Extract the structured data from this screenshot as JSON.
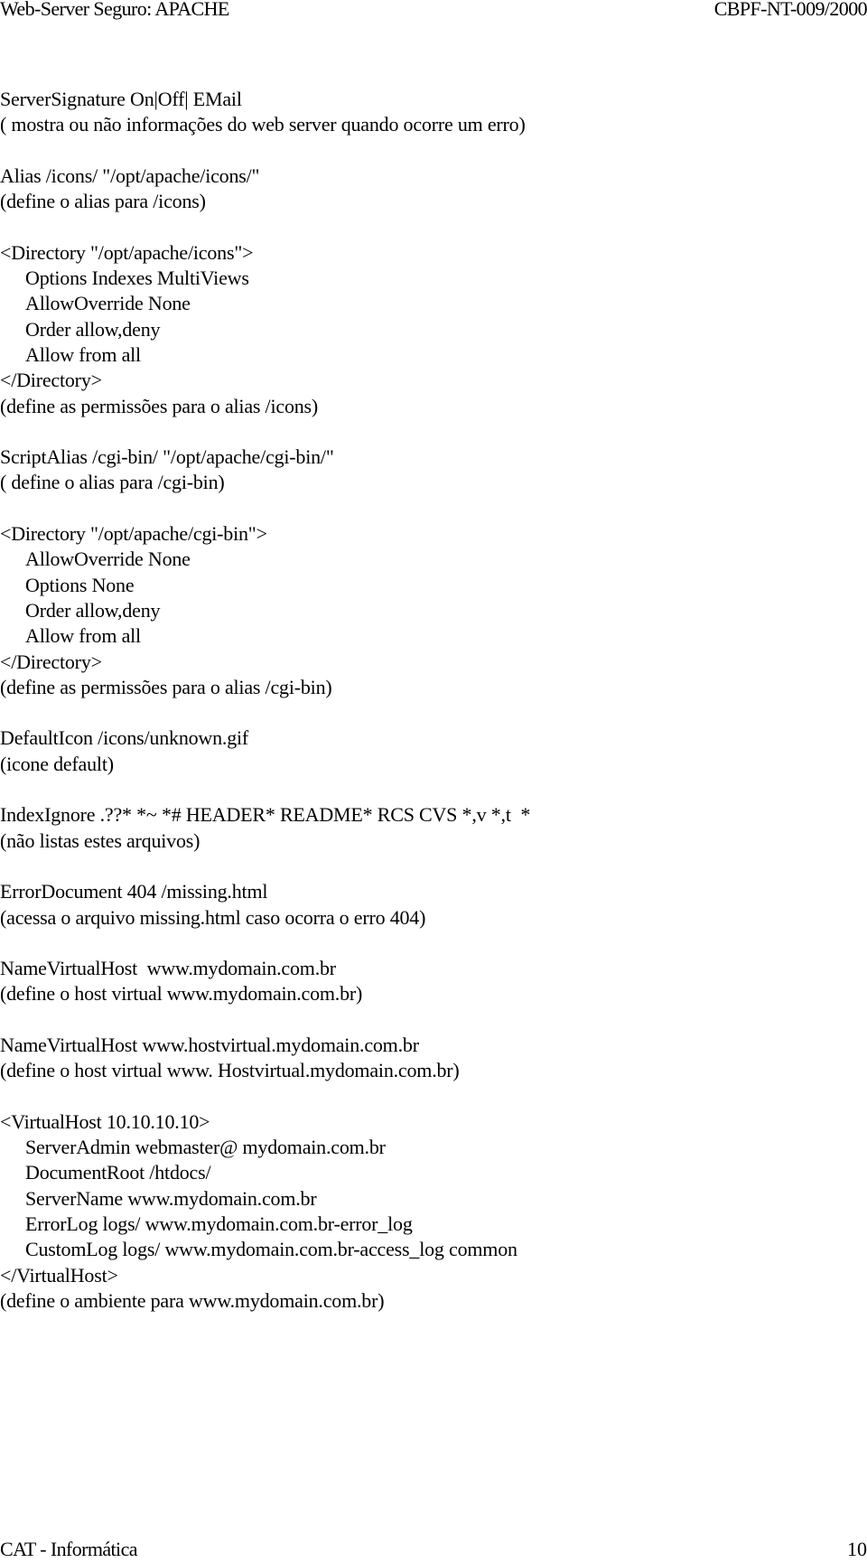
{
  "header": {
    "title": "Web-Server Seguro: APACHE",
    "doc_id": "CBPF-NT-009/2000"
  },
  "lines": [
    {
      "text": "ServerSignature On|Off| EMail",
      "indent": false
    },
    {
      "text": "( mostra ou não informações do web server quando ocorre um erro)",
      "indent": false
    },
    {
      "text": "",
      "indent": false
    },
    {
      "text": "Alias /icons/ \"/opt/apache/icons/\"",
      "indent": false
    },
    {
      "text": "(define o alias para /icons)",
      "indent": false
    },
    {
      "text": "",
      "indent": false
    },
    {
      "text": "<Directory \"/opt/apache/icons\">",
      "indent": false
    },
    {
      "text": "Options Indexes MultiViews",
      "indent": true
    },
    {
      "text": "AllowOverride None",
      "indent": true
    },
    {
      "text": "Order allow,deny",
      "indent": true
    },
    {
      "text": "Allow from all",
      "indent": true
    },
    {
      "text": "</Directory>",
      "indent": false
    },
    {
      "text": "(define as permissões para o alias /icons)",
      "indent": false
    },
    {
      "text": "",
      "indent": false
    },
    {
      "text": "ScriptAlias /cgi-bin/ \"/opt/apache/cgi-bin/\"",
      "indent": false
    },
    {
      "text": "( define o alias para /cgi-bin)",
      "indent": false
    },
    {
      "text": "",
      "indent": false
    },
    {
      "text": "<Directory \"/opt/apache/cgi-bin\">",
      "indent": false
    },
    {
      "text": "AllowOverride None",
      "indent": true
    },
    {
      "text": "Options None",
      "indent": true
    },
    {
      "text": "Order allow,deny",
      "indent": true
    },
    {
      "text": "Allow from all",
      "indent": true
    },
    {
      "text": "</Directory>",
      "indent": false
    },
    {
      "text": "(define as permissões para o alias /cgi-bin)",
      "indent": false
    },
    {
      "text": "",
      "indent": false
    },
    {
      "text": "DefaultIcon /icons/unknown.gif",
      "indent": false
    },
    {
      "text": "(icone default)",
      "indent": false
    },
    {
      "text": "",
      "indent": false
    },
    {
      "text": "IndexIgnore .??* *~ *# HEADER* README* RCS CVS *,v *,t  *",
      "indent": false
    },
    {
      "text": "(não listas estes arquivos)",
      "indent": false
    },
    {
      "text": "",
      "indent": false
    },
    {
      "text": "ErrorDocument 404 /missing.html",
      "indent": false
    },
    {
      "text": "(acessa o arquivo missing.html caso ocorra o erro 404)",
      "indent": false
    },
    {
      "text": "",
      "indent": false
    },
    {
      "text": "NameVirtualHost  www.mydomain.com.br",
      "indent": false
    },
    {
      "text": "(define o host virtual www.mydomain.com.br)",
      "indent": false
    },
    {
      "text": "",
      "indent": false
    },
    {
      "text": "NameVirtualHost www.hostvirtual.mydomain.com.br",
      "indent": false
    },
    {
      "text": "(define o host virtual www. Hostvirtual.mydomain.com.br)",
      "indent": false
    },
    {
      "text": "",
      "indent": false
    },
    {
      "text": "<VirtualHost 10.10.10.10>",
      "indent": false
    },
    {
      "text": "ServerAdmin webmaster@ mydomain.com.br",
      "indent": true
    },
    {
      "text": "DocumentRoot /htdocs/",
      "indent": true
    },
    {
      "text": "ServerName www.mydomain.com.br",
      "indent": true
    },
    {
      "text": "ErrorLog logs/ www.mydomain.com.br-error_log",
      "indent": true
    },
    {
      "text": "CustomLog logs/ www.mydomain.com.br-access_log common",
      "indent": true
    },
    {
      "text": "</VirtualHost>",
      "indent": false
    },
    {
      "text": "(define o ambiente para www.mydomain.com.br)",
      "indent": false
    }
  ],
  "footer": {
    "org": "CAT - Informática",
    "page_number": "10"
  }
}
